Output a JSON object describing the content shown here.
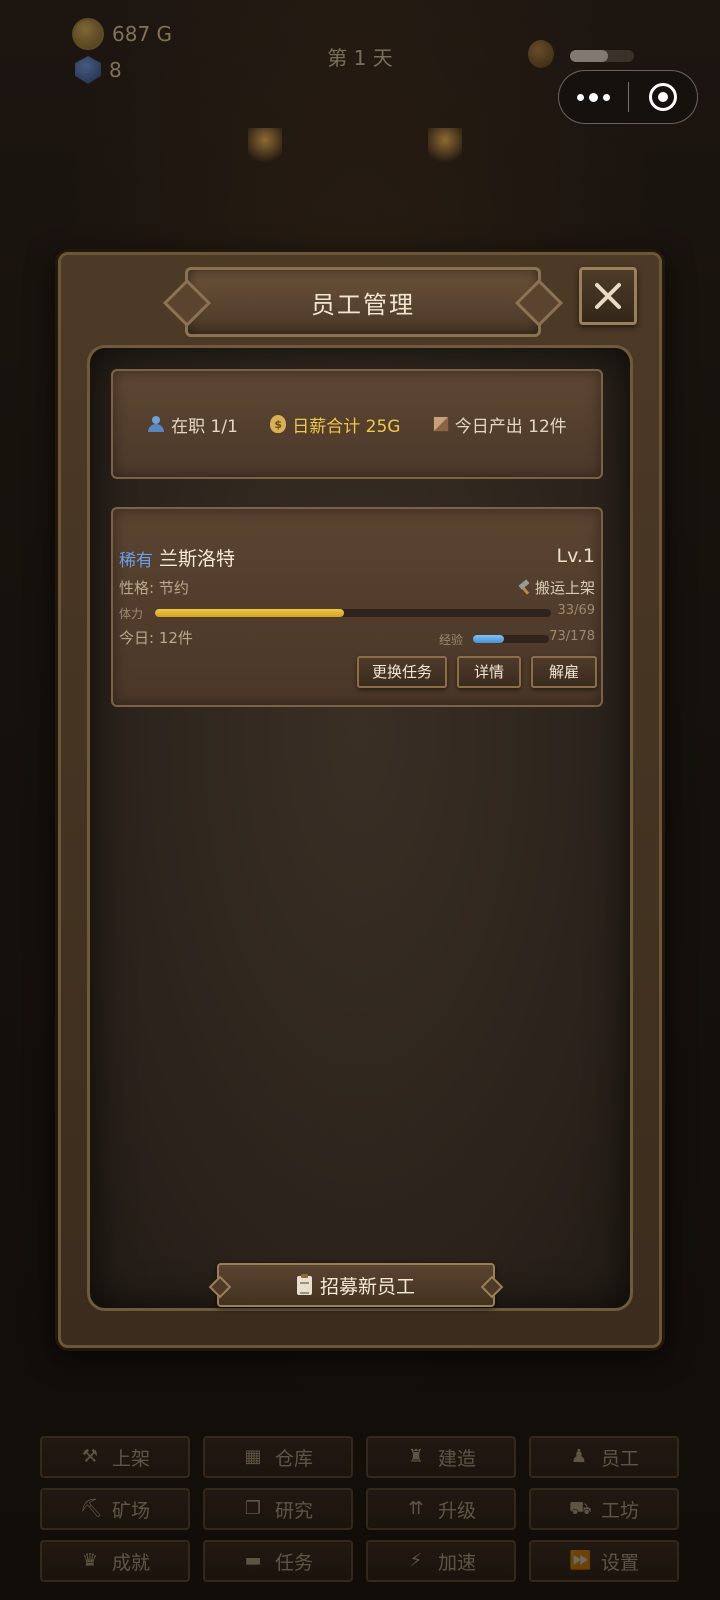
{
  "hud": {
    "gold": "687 G",
    "gems": "8",
    "day": "第 1 天",
    "energy_fraction": 0.6
  },
  "modal": {
    "title": "员工管理",
    "stats": {
      "staff": "在职 1/1",
      "wage": "日薪合计 25G",
      "output": "今日产出 12件"
    },
    "employee": {
      "rarity": "稀有",
      "name": "兰斯洛特",
      "level": "Lv.1",
      "trait": "性格: 节约",
      "task": "搬运上架",
      "stamina_label": "体力",
      "stamina_current": 33,
      "stamina_max": 69,
      "stamina_text": "33/69",
      "today": "今日: 12件",
      "exp_label": "经验",
      "exp_current": 73,
      "exp_max": 178,
      "exp_text": "73/178",
      "buttons": {
        "change_task": "更换任务",
        "details": "详情",
        "dismiss": "解雇"
      }
    },
    "recruit": "招募新员工"
  },
  "bottom_nav": [
    {
      "label": "上架",
      "icon": "hammer-icon",
      "glyph": "⚒"
    },
    {
      "label": "仓库",
      "icon": "box-icon",
      "glyph": "▦"
    },
    {
      "label": "建造",
      "icon": "building-icon",
      "glyph": "♜"
    },
    {
      "label": "员工",
      "icon": "person-icon",
      "glyph": "♟"
    },
    {
      "label": "矿场",
      "icon": "pickaxe-icon",
      "glyph": "⛏"
    },
    {
      "label": "研究",
      "icon": "book-icon",
      "glyph": "❐"
    },
    {
      "label": "升级",
      "icon": "double-up-icon",
      "glyph": "⇈"
    },
    {
      "label": "工坊",
      "icon": "cart-icon",
      "glyph": "⛟"
    },
    {
      "label": "成就",
      "icon": "trophy-icon",
      "glyph": "♛"
    },
    {
      "label": "任务",
      "icon": "blocks-icon",
      "glyph": "▬"
    },
    {
      "label": "加速",
      "icon": "lightning-icon",
      "glyph": "⚡"
    },
    {
      "label": "设置",
      "icon": "fast-forward-icon",
      "glyph": "⏩"
    }
  ],
  "colors": {
    "rarity_rare": "#6c9ee8",
    "stamina": "#e6b934",
    "exp": "#5aa6ea",
    "wage_gold": "#f0c84a"
  }
}
